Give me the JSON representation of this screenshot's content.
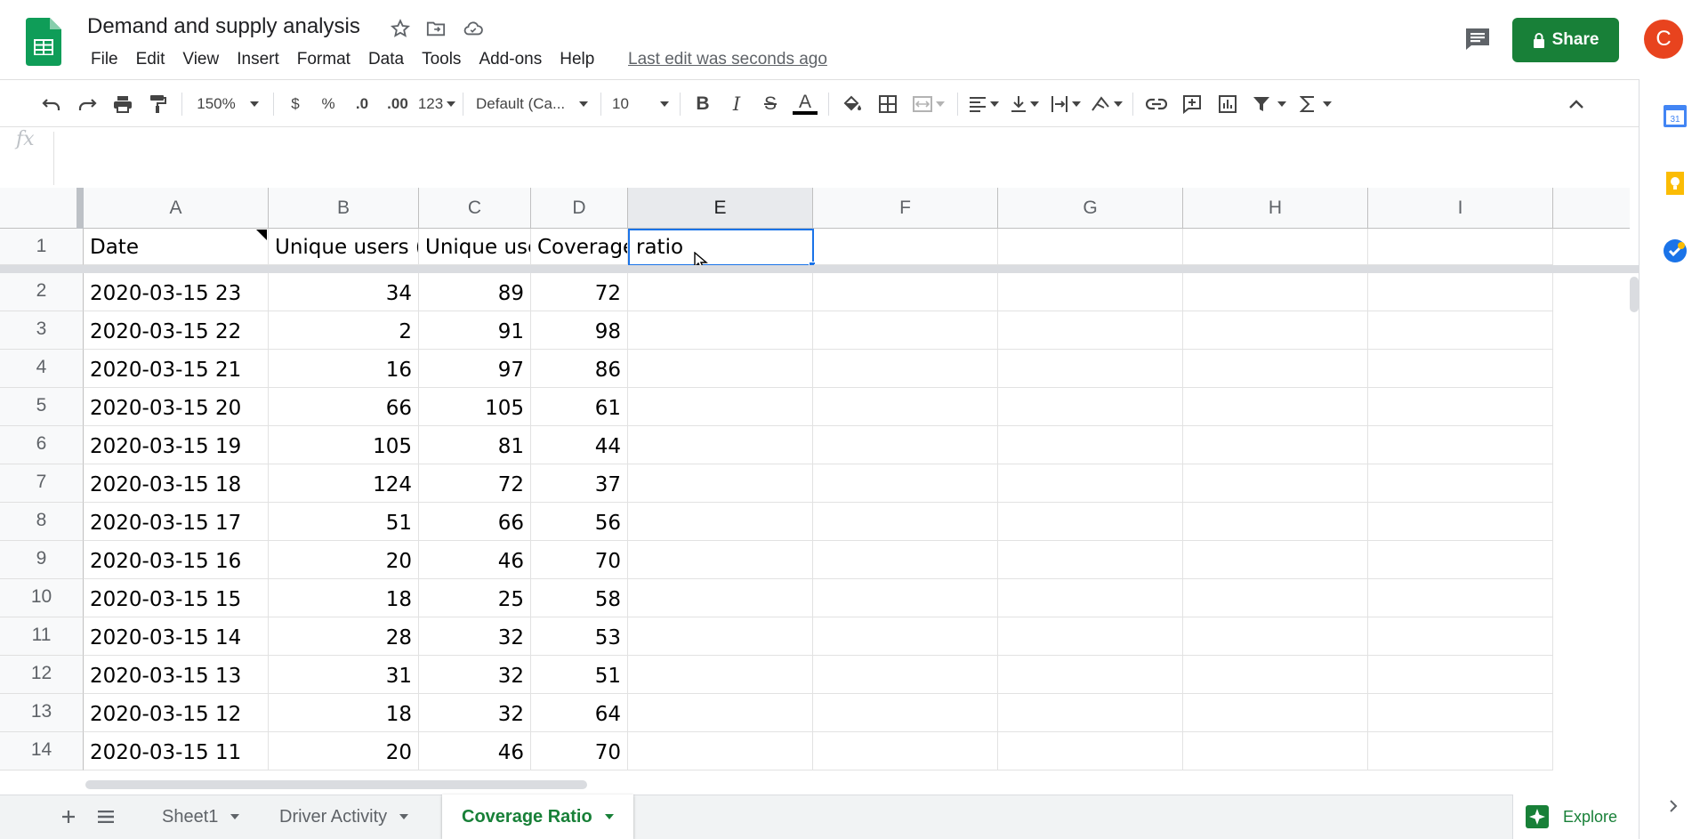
{
  "app": {
    "title": "Demand and supply analysis",
    "last_edit": "Last edit was seconds ago",
    "share_label": "Share",
    "avatar_initial": "C"
  },
  "menu": [
    "File",
    "Edit",
    "View",
    "Insert",
    "Format",
    "Data",
    "Tools",
    "Add-ons",
    "Help"
  ],
  "toolbar": {
    "zoom": "150%",
    "currency": "$",
    "percent": "%",
    "dec_decrease": ".0",
    "dec_increase": ".00",
    "more_formats": "123",
    "font": "Default (Ca...",
    "font_size": "10",
    "bold": "B",
    "italic": "I",
    "strike": "S",
    "text_color": "A"
  },
  "formula_bar": {
    "fx": "fx",
    "value": ""
  },
  "columns": [
    "A",
    "B",
    "C",
    "D",
    "E",
    "F",
    "G",
    "H",
    "I"
  ],
  "selected_column": "E",
  "header_row": {
    "number": "1",
    "cells": [
      "Date",
      "Unique users (",
      "Unique use",
      "Coverage",
      "ratio"
    ]
  },
  "rows": [
    {
      "n": "2",
      "date": "2020-03-15 23",
      "b": "34",
      "c": "89",
      "d": "72"
    },
    {
      "n": "3",
      "date": "2020-03-15 22",
      "b": "2",
      "c": "91",
      "d": "98"
    },
    {
      "n": "4",
      "date": "2020-03-15 21",
      "b": "16",
      "c": "97",
      "d": "86"
    },
    {
      "n": "5",
      "date": "2020-03-15 20",
      "b": "66",
      "c": "105",
      "d": "61"
    },
    {
      "n": "6",
      "date": "2020-03-15 19",
      "b": "105",
      "c": "81",
      "d": "44"
    },
    {
      "n": "7",
      "date": "2020-03-15 18",
      "b": "124",
      "c": "72",
      "d": "37"
    },
    {
      "n": "8",
      "date": "2020-03-15 17",
      "b": "51",
      "c": "66",
      "d": "56"
    },
    {
      "n": "9",
      "date": "2020-03-15 16",
      "b": "20",
      "c": "46",
      "d": "70"
    },
    {
      "n": "10",
      "date": "2020-03-15 15",
      "b": "18",
      "c": "25",
      "d": "58"
    },
    {
      "n": "11",
      "date": "2020-03-15 14",
      "b": "28",
      "c": "32",
      "d": "53"
    },
    {
      "n": "12",
      "date": "2020-03-15 13",
      "b": "31",
      "c": "32",
      "d": "51"
    },
    {
      "n": "13",
      "date": "2020-03-15 12",
      "b": "18",
      "c": "32",
      "d": "64"
    },
    {
      "n": "14",
      "date": "2020-03-15 11",
      "b": "20",
      "c": "46",
      "d": "70"
    }
  ],
  "sheets": {
    "tabs": [
      "Sheet1",
      "Driver Activity",
      "Coverage Ratio"
    ],
    "active": "Coverage Ratio"
  },
  "explore_label": "Explore",
  "colors": {
    "accent_green": "#188038",
    "selection_blue": "#1a73e8",
    "avatar": "#e8431e"
  }
}
